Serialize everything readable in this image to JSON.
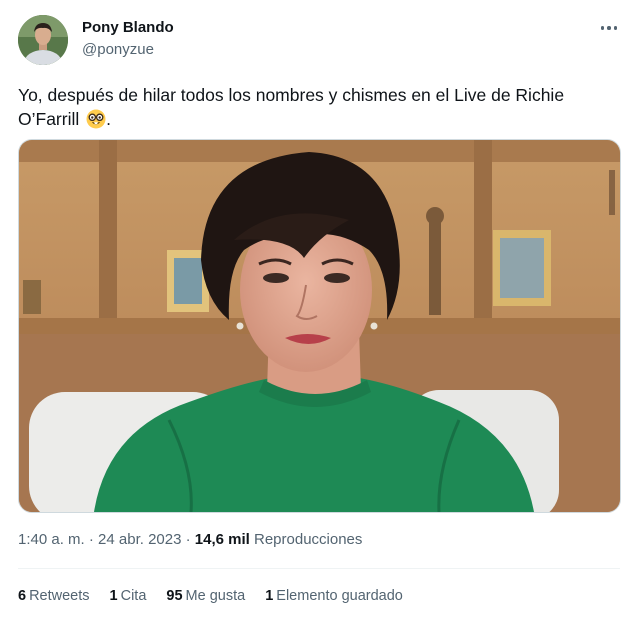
{
  "tweet": {
    "author_name": "Pony Blando",
    "author_handle": "@ponyzue",
    "text": "Yo, después de hilar todos los nombres y chismes en el Live de Richie O’Farrill",
    "text_suffix": ".",
    "emoji": "nerd-face-emoji",
    "more_icon": "more-options-icon",
    "timestamp": "1:40 a. m. · 24 abr. 2023 · ",
    "views_count": "14,6 mil",
    "views_label": " Reproducciones"
  },
  "stats": {
    "retweets_count": "6",
    "retweets_label": "Retweets",
    "quotes_count": "1",
    "quotes_label": "Cita",
    "likes_count": "95",
    "likes_label": "Me gusta",
    "bookmarks_count": "1",
    "bookmarks_label": "Elemento guardado"
  },
  "colors": {
    "text_primary": "#0f1419",
    "text_secondary": "#536471",
    "divider": "#eff3f4",
    "sweater_green": "#1e8a55"
  }
}
